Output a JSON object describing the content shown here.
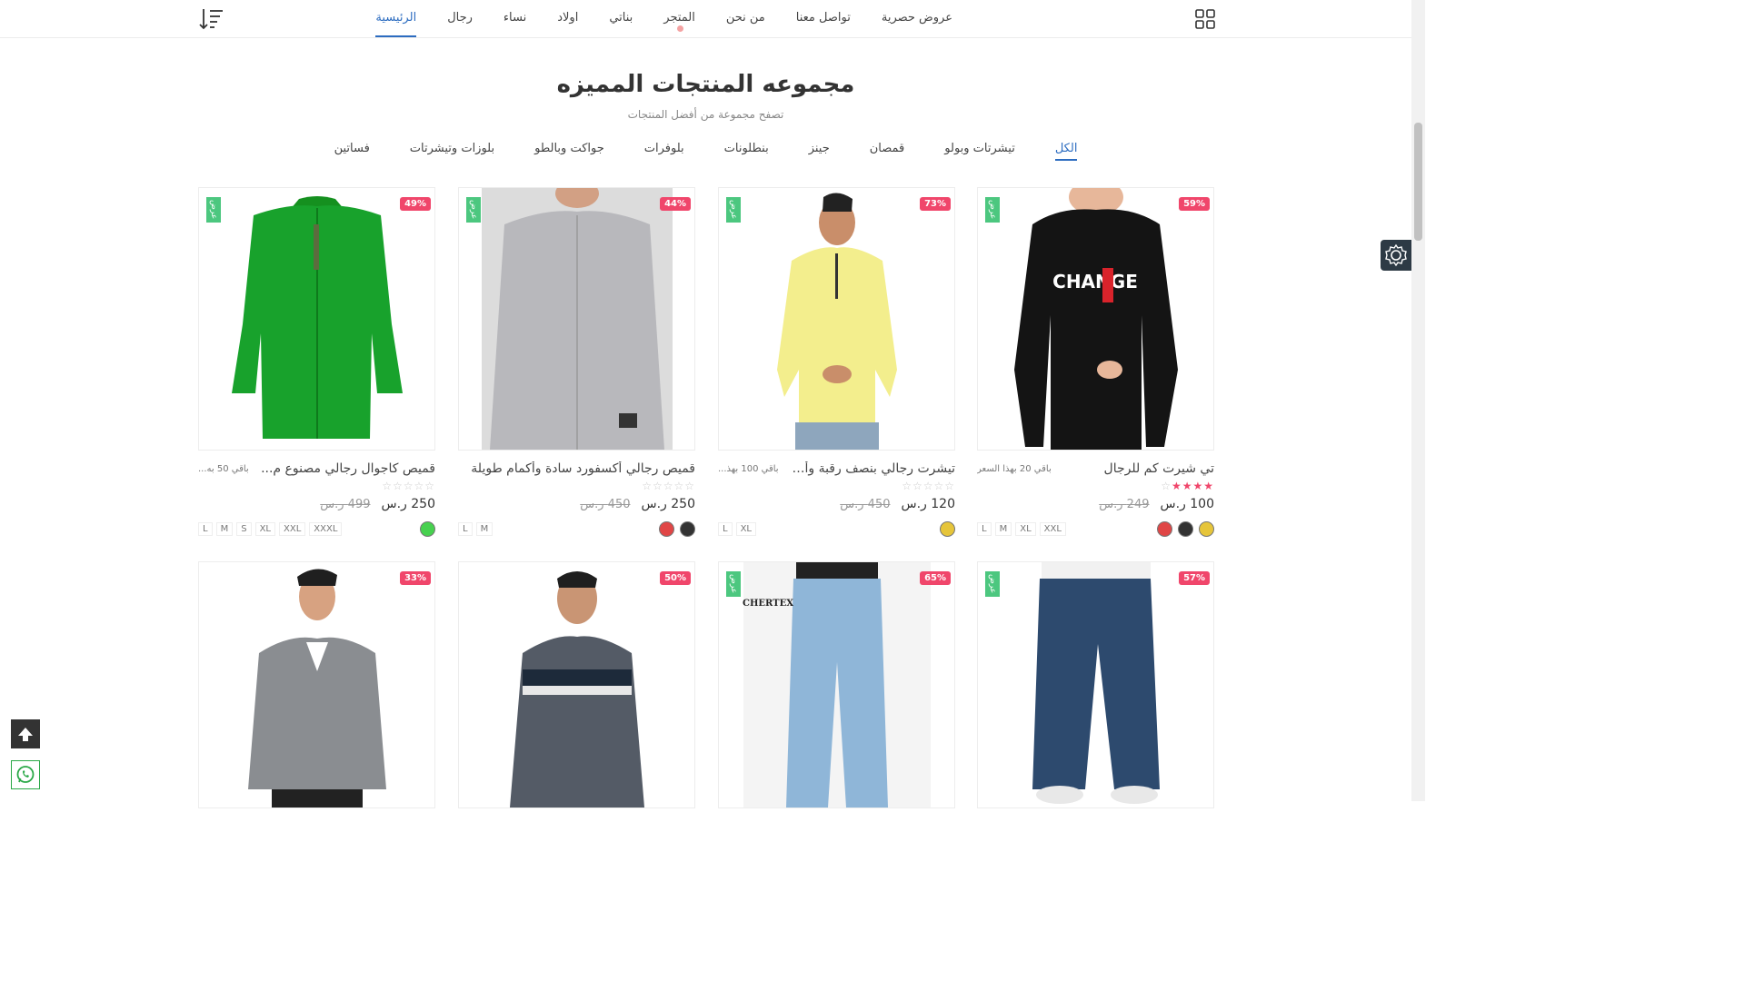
{
  "nav": {
    "items": [
      "الرئيسية",
      "رجال",
      "نساء",
      "اولاد",
      "بناتي",
      "المتجر",
      "من نحن",
      "تواصل معنا",
      "عروض حصرية"
    ],
    "active_index": 0,
    "grid_icon": "grid-icon",
    "sort_icon": "sort-icon"
  },
  "section": {
    "title": "مجموعه المنتجات المميزه",
    "subtitle": "تصفح مجموعة من أفضل المنتجات"
  },
  "tabs": [
    "الكل",
    "تيشرتات وبولو",
    "قمصان",
    "جينز",
    "بنطلونات",
    "بلوفرات",
    "جواكت وبالطو",
    "بلوزات وتيشرتات",
    "فساتين"
  ],
  "colors": {
    "accent": "#2c6cc0",
    "badge": "#f0466b",
    "offer": "#4cc77f"
  },
  "products": [
    {
      "name": "تي شيرت كم للرجال",
      "left": "باقي 20 بهذا السعر",
      "discount": "59%",
      "offer": "عرض",
      "rating": 4,
      "price": "100 ر.س",
      "old_price": "249 ر.س",
      "sizes": [
        "L",
        "M",
        "XL",
        "XXL"
      ],
      "colors": [
        "#e6c53a",
        "#333333",
        "#e04646"
      ]
    },
    {
      "name": "تيشرت رجالي بنصف رقبة وأك...",
      "left": "باقي 100 بهذ...",
      "discount": "73%",
      "offer": "عرض",
      "rating": 0,
      "price": "120 ر.س",
      "old_price": "450 ر.س",
      "sizes": [
        "L",
        "XL"
      ],
      "colors": [
        "#e6c53a"
      ]
    },
    {
      "name": "قميص رجالي أكسفورد سادة وأكمام طويلة",
      "left": "",
      "discount": "44%",
      "offer": "عرض",
      "rating": 0,
      "price": "250 ر.س",
      "old_price": "450 ر.س",
      "sizes": [
        "L",
        "M"
      ],
      "colors": [
        "#333333",
        "#e04646"
      ]
    },
    {
      "name": "قميص كاجوال رجالي مصنوع م...",
      "left": "باقي 50 به...",
      "discount": "49%",
      "offer": "عرض",
      "rating": 0,
      "price": "250 ر.س",
      "old_price": "499 ر.س",
      "sizes": [
        "L",
        "M",
        "S",
        "XL",
        "XXL",
        "XXXL"
      ],
      "colors": [
        "#47d14f"
      ]
    },
    {
      "discount": "57%",
      "offer": "عرض"
    },
    {
      "discount": "65%",
      "offer": "عرض",
      "brand": "CHERTEX"
    },
    {
      "discount": "50%"
    },
    {
      "discount": "33%"
    }
  ],
  "image_change_text": "CHANGE"
}
